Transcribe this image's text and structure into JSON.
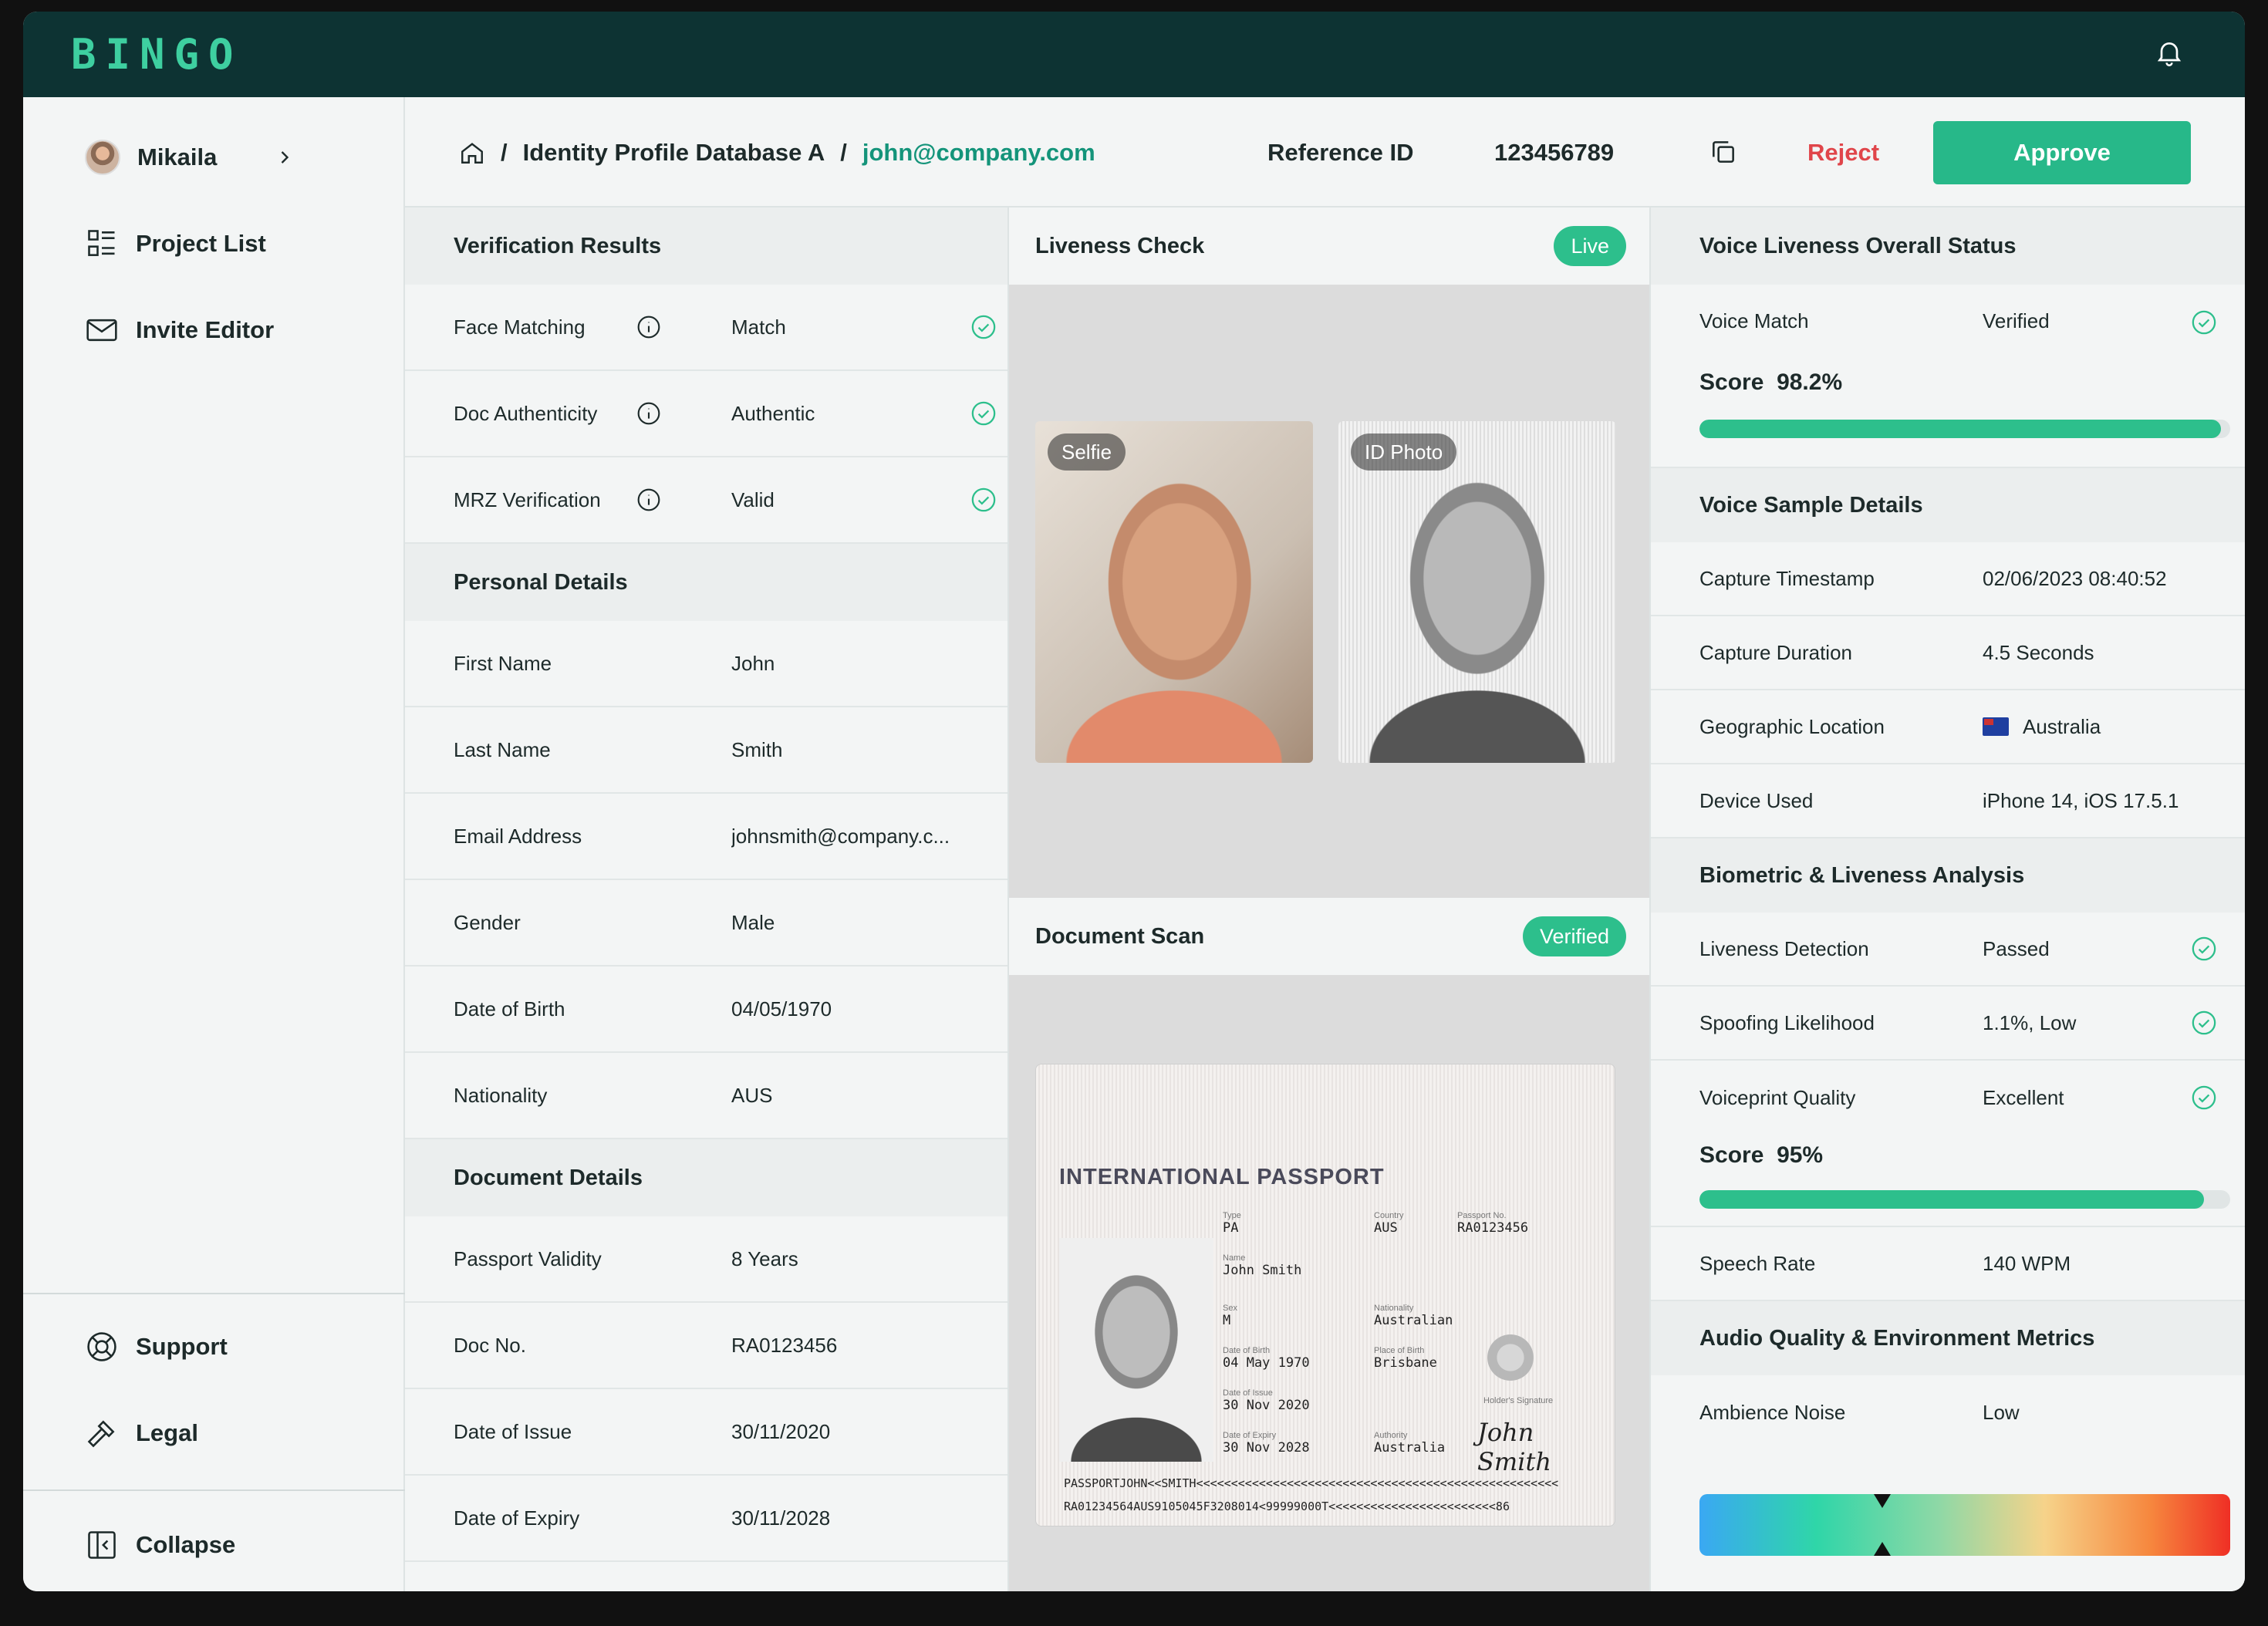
{
  "brand": {
    "logo": "BINGO"
  },
  "sidebar": {
    "user": "Mikaila",
    "items": [
      {
        "label": "Project List"
      },
      {
        "label": "Invite Editor"
      }
    ],
    "bottom": [
      {
        "label": "Support"
      },
      {
        "label": "Legal"
      }
    ],
    "collapse": "Collapse"
  },
  "header": {
    "breadcrumb_db": "Identity Profile Database A",
    "breadcrumb_email": "john@company.com",
    "ref_label": "Reference ID",
    "ref_value": "123456789",
    "reject": "Reject",
    "approve": "Approve"
  },
  "verification": {
    "title": "Verification Results",
    "rows": [
      {
        "label": "Face Matching",
        "value": "Match"
      },
      {
        "label": "Doc Authenticity",
        "value": "Authentic"
      },
      {
        "label": "MRZ Verification",
        "value": "Valid"
      }
    ]
  },
  "personal": {
    "title": "Personal Details",
    "rows": [
      {
        "label": "First Name",
        "value": "John"
      },
      {
        "label": "Last Name",
        "value": "Smith"
      },
      {
        "label": "Email Address",
        "value": "johnsmith@company.c..."
      },
      {
        "label": "Gender",
        "value": "Male"
      },
      {
        "label": "Date of Birth",
        "value": "04/05/1970"
      },
      {
        "label": "Nationality",
        "value": "AUS"
      }
    ]
  },
  "document": {
    "title": "Document Details",
    "rows": [
      {
        "label": "Passport Validity",
        "value": "8 Years"
      },
      {
        "label": "Doc No.",
        "value": "RA0123456"
      },
      {
        "label": "Date of Issue",
        "value": "30/11/2020"
      },
      {
        "label": "Date of Expiry",
        "value": "30/11/2028"
      }
    ]
  },
  "liveness": {
    "title": "Liveness Check",
    "status": "Live",
    "selfie_tag": "Selfie",
    "id_tag": "ID Photo"
  },
  "docscan": {
    "title": "Document Scan",
    "status": "Verified",
    "passport": {
      "heading": "INTERNATIONAL PASSPORT",
      "type_k": "Type",
      "type_v": "PA",
      "country_k": "Country",
      "country_v": "AUS",
      "no_k": "Passport No.",
      "no_v": "RA0123456",
      "name_k": "Name",
      "name_v": "John Smith",
      "sex_k": "Sex",
      "sex_v": "M",
      "nat_k": "Nationality",
      "nat_v": "Australian",
      "dob_k": "Date of Birth",
      "dob_v": "04 May 1970",
      "pob_k": "Place of Birth",
      "pob_v": "Brisbane",
      "doi_k": "Date of Issue",
      "doi_v": "30 Nov 2020",
      "sig_k": "Holder's Signature",
      "sig_v": "John Smith",
      "doe_k": "Date of Expiry",
      "doe_v": "30 Nov 2028",
      "auth_k": "Authority",
      "auth_v": "Australia",
      "mrz1": "PASSPORTJOHN<<SMITH<<<<<<<<<<<<<<<<<<<<<<<<<<<<<<<<<<<<<<<<<<<<<<<<<<<<",
      "mrz2": "RA01234564AUS9105045F3208014<99999000T<<<<<<<<<<<<<<<<<<<<<<<<86"
    }
  },
  "voice": {
    "title": "Voice Liveness Overall Status",
    "match_label": "Voice Match",
    "match_value": "Verified",
    "score_label": "Score",
    "score_value": "98.2%",
    "score": 0.982,
    "sample_title": "Voice Sample Details",
    "sample_rows": [
      {
        "label": "Capture Timestamp",
        "value": "02/06/2023 08:40:52"
      },
      {
        "label": "Capture Duration",
        "value": "4.5 Seconds"
      },
      {
        "label": "Geographic Location",
        "value": "Australia"
      },
      {
        "label": "Device Used",
        "value": "iPhone 14, iOS 17.5.1"
      }
    ],
    "bio_title": "Biometric & Liveness Analysis",
    "bio_rows": [
      {
        "label": "Liveness Detection",
        "value": "Passed"
      },
      {
        "label": "Spoofing Likelihood",
        "value": "1.1%, Low"
      },
      {
        "label": "Voiceprint Quality",
        "value": "Excellent"
      }
    ],
    "bio_score_label": "Score",
    "bio_score_value": "95%",
    "bio_score": 0.95,
    "speech_label": "Speech Rate",
    "speech_value": "140 WPM",
    "audio_title": "Audio Quality & Environment Metrics",
    "noise_label": "Ambience Noise",
    "noise_value": "Low",
    "noise_level": 0.345
  },
  "colors": {
    "accent": "#27b889",
    "topbar": "#0d3333",
    "reject": "#e0454a"
  }
}
